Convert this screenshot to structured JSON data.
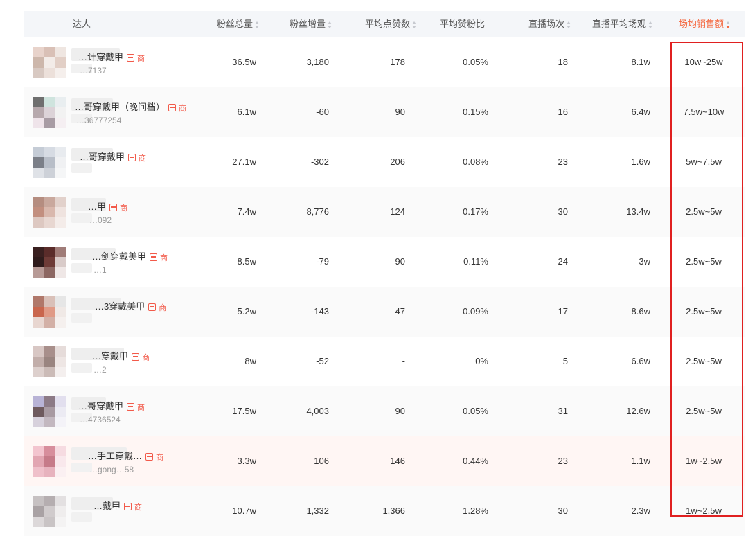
{
  "header": {
    "columns": [
      {
        "key": "talent",
        "label": "达人",
        "sortable": false
      },
      {
        "key": "fans",
        "label": "粉丝总量",
        "sortable": true
      },
      {
        "key": "growth",
        "label": "粉丝增量",
        "sortable": true
      },
      {
        "key": "likes",
        "label": "平均点赞数",
        "sortable": true
      },
      {
        "key": "ratio",
        "label": "平均赞粉比",
        "sortable": false
      },
      {
        "key": "lives",
        "label": "直播场次",
        "sortable": true
      },
      {
        "key": "views",
        "label": "直播平均场观",
        "sortable": true
      },
      {
        "key": "sales",
        "label": "场均销售额",
        "sortable": true,
        "active": true
      }
    ]
  },
  "rows": [
    {
      "name": "…计穿戴甲",
      "uid": "…7137",
      "shop_label": "商",
      "fans": "36.5w",
      "growth": "3,180",
      "likes": "178",
      "ratio": "0.05%",
      "lives": "18",
      "views": "8.1w",
      "sales": "10w~25w"
    },
    {
      "name": "…哥穿戴甲（晚间档）",
      "uid": "…36777254",
      "shop_label": "商",
      "fans": "6.1w",
      "growth": "-60",
      "likes": "90",
      "ratio": "0.15%",
      "lives": "16",
      "views": "6.4w",
      "sales": "7.5w~10w"
    },
    {
      "name": "…哥穿戴甲",
      "uid": "",
      "shop_label": "商",
      "fans": "27.1w",
      "growth": "-302",
      "likes": "206",
      "ratio": "0.08%",
      "lives": "23",
      "views": "1.6w",
      "sales": "5w~7.5w"
    },
    {
      "name": "…甲",
      "uid": "…092",
      "shop_label": "商",
      "fans": "7.4w",
      "growth": "8,776",
      "likes": "124",
      "ratio": "0.17%",
      "lives": "30",
      "views": "13.4w",
      "sales": "2.5w~5w"
    },
    {
      "name": "…剑穿戴美甲",
      "uid": "…1",
      "shop_label": "商",
      "fans": "8.5w",
      "growth": "-79",
      "likes": "90",
      "ratio": "0.11%",
      "lives": "24",
      "views": "3w",
      "sales": "2.5w~5w"
    },
    {
      "name": "…3穿戴美甲",
      "uid": "",
      "shop_label": "商",
      "fans": "5.2w",
      "growth": "-143",
      "likes": "47",
      "ratio": "0.09%",
      "lives": "17",
      "views": "8.6w",
      "sales": "2.5w~5w"
    },
    {
      "name": "…穿戴甲",
      "uid": "…2",
      "shop_label": "商",
      "fans": "8w",
      "growth": "-52",
      "likes": "-",
      "ratio": "0%",
      "lives": "5",
      "views": "6.6w",
      "sales": "2.5w~5w"
    },
    {
      "name": "…哥穿戴甲",
      "uid": "…4736524",
      "shop_label": "商",
      "fans": "17.5w",
      "growth": "4,003",
      "likes": "90",
      "ratio": "0.05%",
      "lives": "31",
      "views": "12.6w",
      "sales": "2.5w~5w"
    },
    {
      "name": "…手工穿戴…",
      "uid": "…gong…58",
      "shop_label": "商",
      "fans": "3.3w",
      "growth": "106",
      "likes": "146",
      "ratio": "0.44%",
      "lives": "23",
      "views": "1.1w",
      "sales": "1w~2.5w"
    },
    {
      "name": "…戴甲",
      "uid": "",
      "shop_label": "商",
      "fans": "10.7w",
      "growth": "1,332",
      "likes": "1,366",
      "ratio": "1.28%",
      "lives": "30",
      "views": "2.3w",
      "sales": "1w~2.5w"
    }
  ],
  "colors": {
    "accent": "#f5683f",
    "highlight_border": "#e02020",
    "badge": "#f25a4a"
  }
}
